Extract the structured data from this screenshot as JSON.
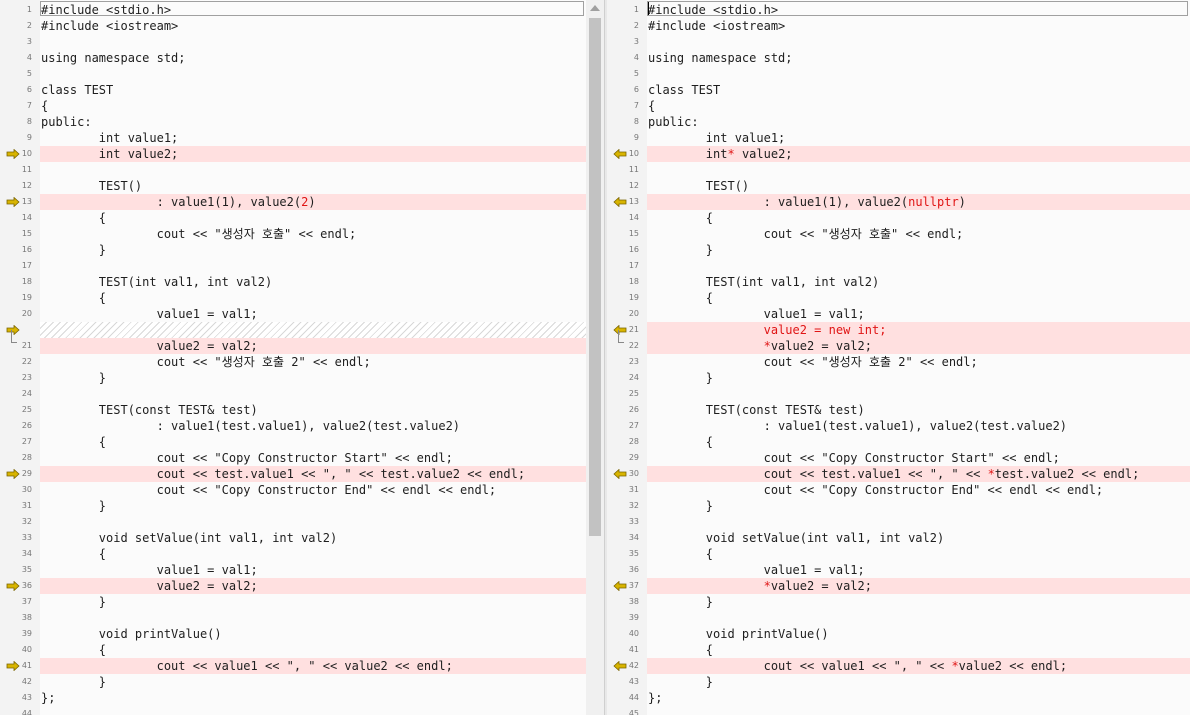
{
  "colors": {
    "diff_bg": "#ffe0e0",
    "highlight_text": "#e01515",
    "arrow": "#d8b400"
  },
  "left": {
    "lines": [
      {
        "n": "1",
        "segs": [
          {
            "t": "#include <stdio.h>"
          }
        ]
      },
      {
        "n": "2",
        "segs": [
          {
            "t": "#include <iostream>"
          }
        ]
      },
      {
        "n": "3",
        "segs": []
      },
      {
        "n": "4",
        "segs": [
          {
            "t": "using namespace std;"
          }
        ]
      },
      {
        "n": "5",
        "segs": []
      },
      {
        "n": "6",
        "segs": [
          {
            "t": "class TEST"
          }
        ]
      },
      {
        "n": "7",
        "segs": [
          {
            "t": "{"
          }
        ]
      },
      {
        "n": "8",
        "segs": [
          {
            "t": "public:"
          }
        ]
      },
      {
        "n": "9",
        "segs": [
          {
            "t": "        int value1;"
          }
        ]
      },
      {
        "n": "10",
        "diff": true,
        "marker": "arrow",
        "segs": [
          {
            "t": "        int value2;"
          }
        ]
      },
      {
        "n": "11",
        "segs": []
      },
      {
        "n": "12",
        "segs": [
          {
            "t": "        TEST()"
          }
        ]
      },
      {
        "n": "13",
        "diff": true,
        "marker": "arrow",
        "segs": [
          {
            "t": "                : value1(1), value2("
          },
          {
            "t": "2",
            "hl": true
          },
          {
            "t": ")"
          }
        ]
      },
      {
        "n": "14",
        "segs": [
          {
            "t": "        {"
          }
        ]
      },
      {
        "n": "15",
        "segs": [
          {
            "t": "                cout << \"생성자 호출\" << endl;"
          }
        ]
      },
      {
        "n": "16",
        "segs": [
          {
            "t": "        }"
          }
        ]
      },
      {
        "n": "17",
        "segs": []
      },
      {
        "n": "18",
        "segs": [
          {
            "t": "        TEST(int val1, int val2)"
          }
        ]
      },
      {
        "n": "19",
        "segs": [
          {
            "t": "        {"
          }
        ]
      },
      {
        "n": "20",
        "segs": [
          {
            "t": "                value1 = val1;"
          }
        ]
      },
      {
        "n": "",
        "filler": true,
        "marker": "arrow",
        "segs": []
      },
      {
        "n": "21",
        "diff": true,
        "marker": "bracket",
        "segs": [
          {
            "t": "                value2 = val2;"
          }
        ]
      },
      {
        "n": "22",
        "segs": [
          {
            "t": "                cout << \"생성자 호출 2\" << endl;"
          }
        ]
      },
      {
        "n": "23",
        "segs": [
          {
            "t": "        }"
          }
        ]
      },
      {
        "n": "24",
        "segs": []
      },
      {
        "n": "25",
        "segs": [
          {
            "t": "        TEST(const TEST& test)"
          }
        ]
      },
      {
        "n": "26",
        "segs": [
          {
            "t": "                : value1(test.value1), value2(test.value2)"
          }
        ]
      },
      {
        "n": "27",
        "segs": [
          {
            "t": "        {"
          }
        ]
      },
      {
        "n": "28",
        "segs": [
          {
            "t": "                cout << \"Copy Constructor Start\" << endl;"
          }
        ]
      },
      {
        "n": "29",
        "diff": true,
        "marker": "arrow",
        "segs": [
          {
            "t": "                cout << test.value1 << \", \" << test.value2 << endl;"
          }
        ]
      },
      {
        "n": "30",
        "segs": [
          {
            "t": "                cout << \"Copy Constructor End\" << endl << endl;"
          }
        ]
      },
      {
        "n": "31",
        "segs": [
          {
            "t": "        }"
          }
        ]
      },
      {
        "n": "32",
        "segs": []
      },
      {
        "n": "33",
        "segs": [
          {
            "t": "        void setValue(int val1, int val2)"
          }
        ]
      },
      {
        "n": "34",
        "segs": [
          {
            "t": "        {"
          }
        ]
      },
      {
        "n": "35",
        "segs": [
          {
            "t": "                value1 = val1;"
          }
        ]
      },
      {
        "n": "36",
        "diff": true,
        "marker": "arrow",
        "segs": [
          {
            "t": "                value2 = val2;"
          }
        ]
      },
      {
        "n": "37",
        "segs": [
          {
            "t": "        }"
          }
        ]
      },
      {
        "n": "38",
        "segs": []
      },
      {
        "n": "39",
        "segs": [
          {
            "t": "        void printValue()"
          }
        ]
      },
      {
        "n": "40",
        "segs": [
          {
            "t": "        {"
          }
        ]
      },
      {
        "n": "41",
        "diff": true,
        "marker": "arrow",
        "segs": [
          {
            "t": "                cout << value1 << \", \" << value2 << endl;"
          }
        ]
      },
      {
        "n": "42",
        "segs": [
          {
            "t": "        }"
          }
        ]
      },
      {
        "n": "43",
        "segs": [
          {
            "t": "};"
          }
        ]
      },
      {
        "n": "44",
        "segs": []
      }
    ]
  },
  "right": {
    "lines": [
      {
        "n": "1",
        "segs": [
          {
            "t": "#include <stdio.h>"
          }
        ]
      },
      {
        "n": "2",
        "segs": [
          {
            "t": "#include <iostream>"
          }
        ]
      },
      {
        "n": "3",
        "segs": []
      },
      {
        "n": "4",
        "segs": [
          {
            "t": "using namespace std;"
          }
        ]
      },
      {
        "n": "5",
        "segs": []
      },
      {
        "n": "6",
        "segs": [
          {
            "t": "class TEST"
          }
        ]
      },
      {
        "n": "7",
        "segs": [
          {
            "t": "{"
          }
        ]
      },
      {
        "n": "8",
        "segs": [
          {
            "t": "public:"
          }
        ]
      },
      {
        "n": "9",
        "segs": [
          {
            "t": "        int value1;"
          }
        ]
      },
      {
        "n": "10",
        "diff": true,
        "marker": "arrow",
        "segs": [
          {
            "t": "        int"
          },
          {
            "t": "*",
            "hl": true
          },
          {
            "t": " value2;"
          }
        ]
      },
      {
        "n": "11",
        "segs": []
      },
      {
        "n": "12",
        "segs": [
          {
            "t": "        TEST()"
          }
        ]
      },
      {
        "n": "13",
        "diff": true,
        "marker": "arrow",
        "segs": [
          {
            "t": "                : value1(1), value2("
          },
          {
            "t": "nullptr",
            "hl": true
          },
          {
            "t": ")"
          }
        ]
      },
      {
        "n": "14",
        "segs": [
          {
            "t": "        {"
          }
        ]
      },
      {
        "n": "15",
        "segs": [
          {
            "t": "                cout << \"생성자 호출\" << endl;"
          }
        ]
      },
      {
        "n": "16",
        "segs": [
          {
            "t": "        }"
          }
        ]
      },
      {
        "n": "17",
        "segs": []
      },
      {
        "n": "18",
        "segs": [
          {
            "t": "        TEST(int val1, int val2)"
          }
        ]
      },
      {
        "n": "19",
        "segs": [
          {
            "t": "        {"
          }
        ]
      },
      {
        "n": "20",
        "segs": [
          {
            "t": "                value1 = val1;"
          }
        ]
      },
      {
        "n": "21",
        "diff": true,
        "marker": "arrow",
        "segs": [
          {
            "t": "                "
          },
          {
            "t": "value2 = new int;",
            "hl": true
          }
        ]
      },
      {
        "n": "22",
        "diff": true,
        "marker": "bracket",
        "segs": [
          {
            "t": "                "
          },
          {
            "t": "*",
            "hl": true
          },
          {
            "t": "value2 = val2;"
          }
        ]
      },
      {
        "n": "23",
        "segs": [
          {
            "t": "                cout << \"생성자 호출 2\" << endl;"
          }
        ]
      },
      {
        "n": "24",
        "segs": [
          {
            "t": "        }"
          }
        ]
      },
      {
        "n": "25",
        "segs": []
      },
      {
        "n": "26",
        "segs": [
          {
            "t": "        TEST(const TEST& test)"
          }
        ]
      },
      {
        "n": "27",
        "segs": [
          {
            "t": "                : value1(test.value1), value2(test.value2)"
          }
        ]
      },
      {
        "n": "28",
        "segs": [
          {
            "t": "        {"
          }
        ]
      },
      {
        "n": "29",
        "segs": [
          {
            "t": "                cout << \"Copy Constructor Start\" << endl;"
          }
        ]
      },
      {
        "n": "30",
        "diff": true,
        "marker": "arrow",
        "segs": [
          {
            "t": "                cout << test.value1 << \", \" << "
          },
          {
            "t": "*",
            "hl": true
          },
          {
            "t": "test.value2 << endl;"
          }
        ]
      },
      {
        "n": "31",
        "segs": [
          {
            "t": "                cout << \"Copy Constructor End\" << endl << endl;"
          }
        ]
      },
      {
        "n": "32",
        "segs": [
          {
            "t": "        }"
          }
        ]
      },
      {
        "n": "33",
        "segs": []
      },
      {
        "n": "34",
        "segs": [
          {
            "t": "        void setValue(int val1, int val2)"
          }
        ]
      },
      {
        "n": "35",
        "segs": [
          {
            "t": "        {"
          }
        ]
      },
      {
        "n": "36",
        "segs": [
          {
            "t": "                value1 = val1;"
          }
        ]
      },
      {
        "n": "37",
        "diff": true,
        "marker": "arrow",
        "segs": [
          {
            "t": "                "
          },
          {
            "t": "*",
            "hl": true
          },
          {
            "t": "value2 = val2;"
          }
        ]
      },
      {
        "n": "38",
        "segs": [
          {
            "t": "        }"
          }
        ]
      },
      {
        "n": "39",
        "segs": []
      },
      {
        "n": "40",
        "segs": [
          {
            "t": "        void printValue()"
          }
        ]
      },
      {
        "n": "41",
        "segs": [
          {
            "t": "        {"
          }
        ]
      },
      {
        "n": "42",
        "diff": true,
        "marker": "arrow",
        "segs": [
          {
            "t": "                cout << value1 << \", \" << "
          },
          {
            "t": "*",
            "hl": true
          },
          {
            "t": "value2 << endl;"
          }
        ]
      },
      {
        "n": "43",
        "segs": [
          {
            "t": "        }"
          }
        ]
      },
      {
        "n": "44",
        "segs": [
          {
            "t": "};"
          }
        ]
      },
      {
        "n": "45",
        "segs": []
      }
    ]
  }
}
